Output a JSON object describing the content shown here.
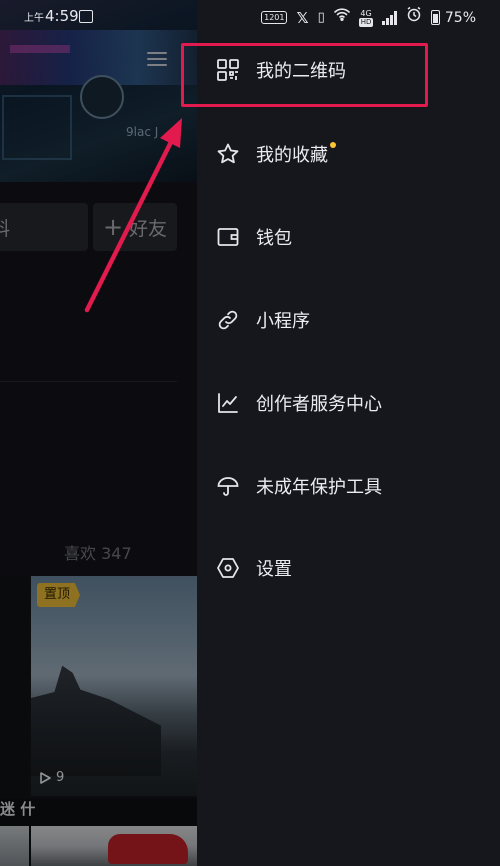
{
  "status_bar": {
    "time_prefix": "上午",
    "time": "4:59",
    "hd_badge": "HD",
    "network": "4G",
    "battery": "75%"
  },
  "background_page": {
    "left_button_label": "料",
    "add_friend_label": "好友",
    "likes_label": "喜欢 347",
    "pinned_badge": "置顶",
    "play_count": "9",
    "row2_caption": "迷 什",
    "cover_text": "9lac J"
  },
  "drawer": {
    "items": [
      {
        "label": "我的二维码",
        "icon": "qr-code-icon"
      },
      {
        "label": "我的收藏",
        "icon": "star-icon",
        "dot_color": "#fbc433"
      },
      {
        "label": "钱包",
        "icon": "wallet-icon"
      },
      {
        "label": "小程序",
        "icon": "link-icon"
      },
      {
        "label": "创作者服务中心",
        "icon": "chart-line-icon"
      },
      {
        "label": "未成年保护工具",
        "icon": "umbrella-icon"
      },
      {
        "label": "设置",
        "icon": "hexagon-settings-icon"
      }
    ]
  },
  "annotation": {
    "highlight_color": "#e21a4d"
  }
}
